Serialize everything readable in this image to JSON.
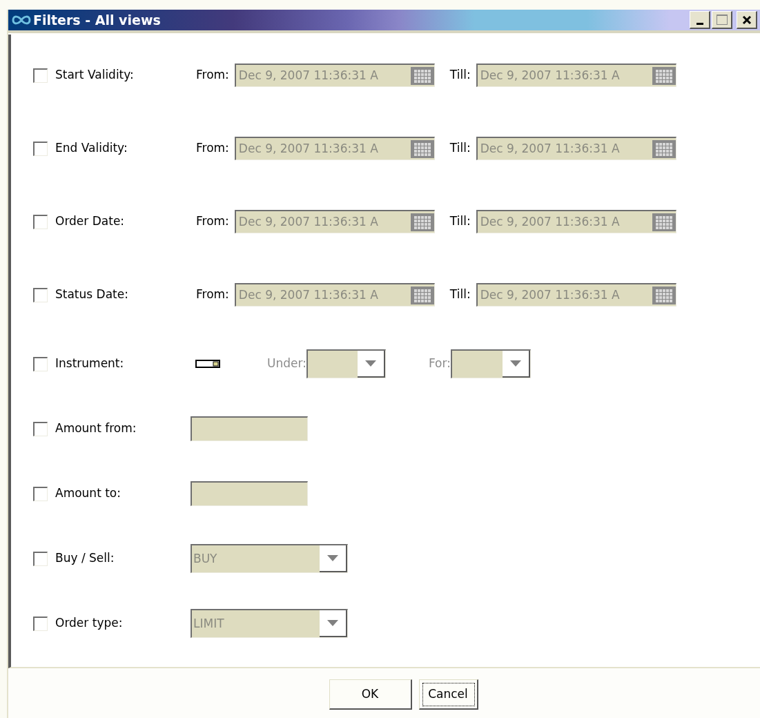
{
  "window": {
    "title": "Filters - All views"
  },
  "rows": [
    {
      "kind": "date_range",
      "label": "Start Validity:",
      "checked": false,
      "disabled": true,
      "from": {
        "label": "From:",
        "value": "Dec 9, 2007 11:36:31 A"
      },
      "till": {
        "label": "Till:",
        "value": "Dec 9, 2007 11:36:31 A"
      }
    },
    {
      "kind": "date_range",
      "label": "End Validity:",
      "checked": false,
      "disabled": true,
      "from": {
        "label": "From:",
        "value": "Dec 9, 2007 11:36:31 A"
      },
      "till": {
        "label": "Till:",
        "value": "Dec 9, 2007 11:36:31 A"
      }
    },
    {
      "kind": "date_range",
      "label": "Order Date:",
      "checked": false,
      "disabled": true,
      "from": {
        "label": "From:",
        "value": "Dec 9, 2007 11:36:31 A"
      },
      "till": {
        "label": "Till:",
        "value": "Dec 9, 2007 11:36:31 A"
      }
    },
    {
      "kind": "date_range",
      "label": "Status Date:",
      "checked": false,
      "disabled": true,
      "from": {
        "label": "From:",
        "value": "Dec 9, 2007 11:36:31 A"
      },
      "till": {
        "label": "Till:",
        "value": "Dec 9, 2007 11:36:31 A"
      }
    },
    {
      "kind": "instrument",
      "label": "Instrument:",
      "checked": false,
      "disabled": true,
      "under_label": "Under:",
      "for_label": "For:"
    },
    {
      "kind": "text",
      "label": "Amount from:",
      "checked": false,
      "disabled": true
    },
    {
      "kind": "text",
      "label": "Amount to:",
      "checked": false,
      "disabled": true
    },
    {
      "kind": "combo",
      "label": "Buy / Sell:",
      "checked": false,
      "disabled": true,
      "value": "BUY"
    },
    {
      "kind": "combo",
      "label": "Order type:",
      "checked": false,
      "disabled": true,
      "value": "LIMIT"
    }
  ],
  "buttons": [
    {
      "label": "OK",
      "focused": false
    },
    {
      "label": "Cancel",
      "focused": true
    }
  ]
}
